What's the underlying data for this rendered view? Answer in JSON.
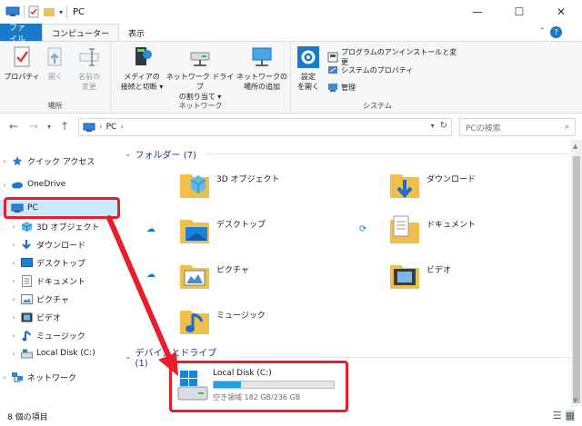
{
  "window": {
    "title": "PC"
  },
  "ribbon_tabs": [
    "ファイル",
    "コンピューター",
    "表示"
  ],
  "ribbon": {
    "location_group": {
      "label": "場所",
      "properties": "プロパティ",
      "open": "開く",
      "rename": [
        "名前の",
        "変更"
      ]
    },
    "network_group": {
      "label": "ネットワーク",
      "media_access": [
        "メディアの",
        "接続と切断 ▾"
      ],
      "map_drive": [
        "ネットワーク ドライブ",
        "の割り当て ▾"
      ],
      "add_location": [
        "ネットワークの",
        "場所の追加"
      ]
    },
    "system_group": {
      "label": "システム",
      "settings": [
        "設定",
        "を開く"
      ],
      "uninstall": "プログラムのアンインストールと変更",
      "system_properties": "システムのプロパティ",
      "manage": "管理"
    }
  },
  "address": {
    "path": "PC",
    "sep": "›",
    "search_placeholder": "PCの検索"
  },
  "nav": {
    "quick_access": "クイック アクセス",
    "onedrive": "OneDrive",
    "pc": "PC",
    "children": [
      "3D オブジェクト",
      "ダウンロード",
      "デスクトップ",
      "ドキュメント",
      "ピクチャ",
      "ビデオ",
      "ミュージック",
      "Local Disk (C:)"
    ],
    "network": "ネットワーク"
  },
  "folders_section": "フォルダー (7)",
  "folders": [
    "3D オブジェクト",
    "ダウンロード",
    "デスクトップ",
    "ドキュメント",
    "ピクチャ",
    "ビデオ",
    "ミュージック"
  ],
  "devices_section": "デバイスとドライブ (1)",
  "drive": {
    "name": "Local Disk (C:)",
    "free_text": "空き領域 182 GB/236 GB",
    "used_fraction": 0.23
  },
  "status": {
    "count": "8 個の項目"
  },
  "colors": {
    "accent": "#1979ca",
    "highlight": "#e5202a",
    "folder": "#f5c14a",
    "nav_selected": "#cce8ff"
  }
}
